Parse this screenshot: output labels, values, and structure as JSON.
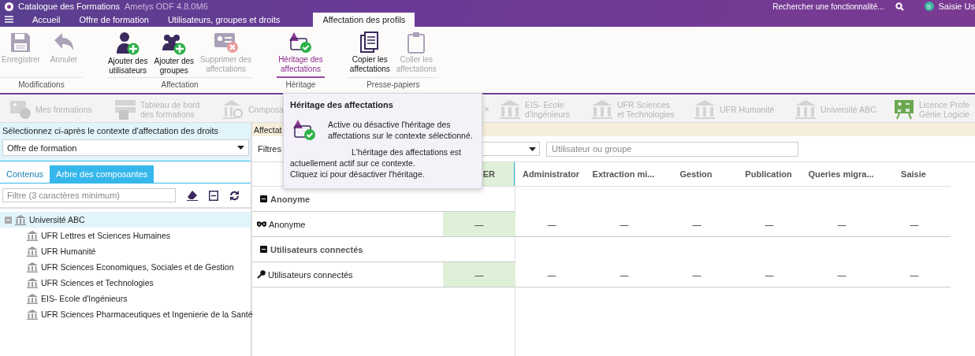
{
  "title_bar": {
    "app_title": "Catalogue des Formations",
    "version": "Ametys ODF 4.8.0M6",
    "search_label": "Rechercher une fonctionnalité...",
    "user_initial": "S",
    "user_name": "Saisie Us"
  },
  "menu_tabs": [
    {
      "label": "Accueil",
      "selected": false
    },
    {
      "label": "Offre de formation",
      "selected": false
    },
    {
      "label": "Utilisateurs, groupes et droits",
      "selected": false
    },
    {
      "label": "Affectation des profils",
      "selected": true
    }
  ],
  "ribbon_groups": [
    {
      "label": "Modifications",
      "active": false,
      "buttons": [
        {
          "label": "Enregistrer",
          "kind": "save",
          "disabled": true,
          "active": false
        },
        {
          "label": "Annuler",
          "kind": "undo",
          "disabled": true,
          "active": false
        }
      ]
    },
    {
      "label": "Affectation",
      "active": false,
      "buttons": [
        {
          "label": "Ajouter des\nutilisateurs",
          "kind": "add-user",
          "disabled": false,
          "active": false
        },
        {
          "label": "Ajouter des\ngroupes",
          "kind": "add-group",
          "disabled": false,
          "active": false
        },
        {
          "label": "Supprimer des\naffectations",
          "kind": "remove",
          "disabled": true,
          "active": false
        }
      ]
    },
    {
      "label": "Héritage",
      "active": true,
      "buttons": [
        {
          "label": "Héritage des\naffectations",
          "kind": "inherit",
          "disabled": false,
          "active": true
        }
      ]
    },
    {
      "label": "Presse-papiers",
      "active": false,
      "buttons": [
        {
          "label": "Copier les\naffectations",
          "kind": "copy",
          "disabled": false,
          "active": false
        },
        {
          "label": "Coller les\naffectations",
          "kind": "paste",
          "disabled": true,
          "active": false
        }
      ]
    }
  ],
  "open_tabs": [
    {
      "label": "Mes formations",
      "kind": "course"
    },
    {
      "label": "Tableau de bord\ndes formations",
      "kind": "dashboard"
    },
    {
      "label": "Composa",
      "kind": "org-search",
      "close": "×"
    },
    {
      "label": "EIS- Ecole\nd'Ingénieurs",
      "kind": "institution"
    },
    {
      "label": "UFR Sciences\net Technologies",
      "kind": "institution"
    },
    {
      "label": "UFR Humanité",
      "kind": "institution"
    },
    {
      "label": "Université ABC",
      "kind": "institution"
    },
    {
      "label": "Licence Profe\nGénie Logicie",
      "kind": "diploma"
    }
  ],
  "left_panel": {
    "context_label": "Sélectionnez ci-après le contexte d'affectation des droits",
    "context_value": "Offre de formation",
    "tabs": [
      {
        "label": "Contenus",
        "selected": false
      },
      {
        "label": "Arbre des composantes",
        "selected": true
      }
    ],
    "filter_placeholder": "Filtre (3 caractères minimum)",
    "tree": [
      {
        "label": "Université ABC",
        "expanded": true,
        "selected": true,
        "children": [
          {
            "label": "UFR Lettres et Sciences Humaines",
            "selected": false
          },
          {
            "label": "UFR Humanité",
            "selected": false
          },
          {
            "label": "UFR Sciences Economiques, Sociales et de Gestion",
            "selected": false
          },
          {
            "label": "UFR Sciences et Technologies",
            "selected": false
          },
          {
            "label": "EIS- Ecole d'Ingénieurs",
            "selected": false
          },
          {
            "label": "UFR Sciences Pharmaceutiques et Ingenierie de la Santé",
            "selected": false
          }
        ]
      }
    ]
  },
  "right_panel": {
    "header": "Affectat",
    "filters_label": "Filtres",
    "user_placeholder": "Utilisateur ou groupe",
    "columns": [
      {
        "label": "ER",
        "highlighted": true
      },
      {
        "label": "Administrator",
        "highlighted": false
      },
      {
        "label": "Extraction mi...",
        "highlighted": false
      },
      {
        "label": "Gestion",
        "highlighted": false
      },
      {
        "label": "Publication",
        "highlighted": false
      },
      {
        "label": "Queries migra...",
        "highlighted": false
      },
      {
        "label": "Saisie",
        "highlighted": false
      }
    ],
    "groups": [
      {
        "label": "Anonyme",
        "expanded": true,
        "rows": [
          {
            "label": "Anonyme",
            "kind": "mask",
            "cells": [
              "—",
              "—",
              "—",
              "—",
              "—",
              "—",
              "—"
            ]
          }
        ]
      },
      {
        "label": "Utilisateurs connectés",
        "expanded": true,
        "rows": [
          {
            "label": "Utilisateurs connectés",
            "kind": "key",
            "cells": [
              "—",
              "—",
              "—",
              "—",
              "—",
              "—",
              "—"
            ]
          }
        ]
      }
    ]
  },
  "tooltip": {
    "title": "Héritage des affectations",
    "paragraphs": [
      "Active ou désactive l'héritage des affectations sur le contexte sélectionné.",
      "L'héritage des affectations est actuellement actif sur ce contexte.",
      "Cliquez ici pour désactiver l'héritage."
    ]
  }
}
